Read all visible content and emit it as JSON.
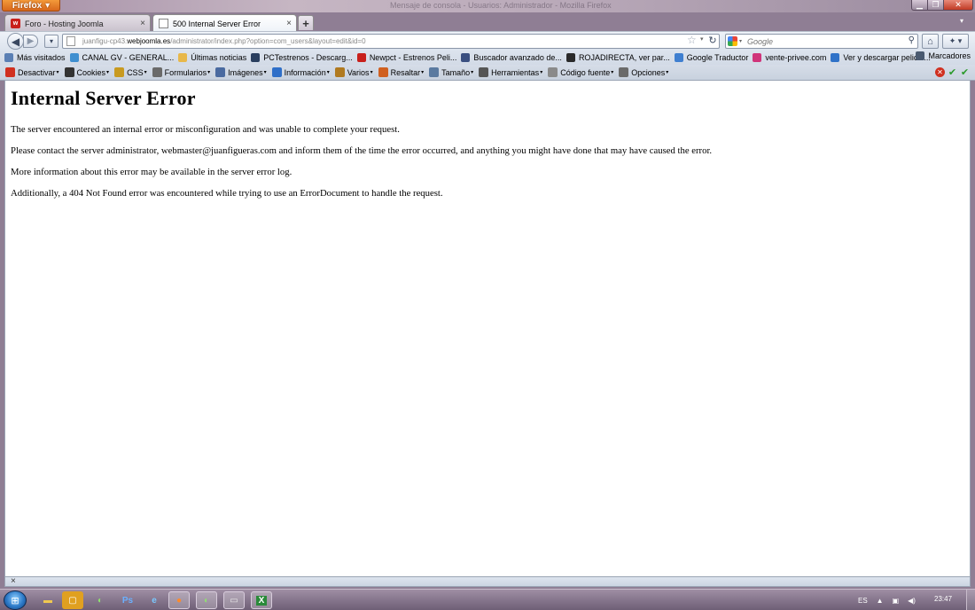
{
  "titlebar": {
    "menu_label": "Firefox",
    "window_title": "Mensaje de consola - Usuarios: Administrador - Mozilla Firefox"
  },
  "tabs": [
    {
      "label": "Foro - Hosting Joomla",
      "active": false
    },
    {
      "label": "500 Internal Server Error",
      "active": true
    }
  ],
  "navbar": {
    "url_prefix": "juanfigu-cp43.",
    "url_host": "webjoomla.es",
    "url_path": "/administrator/index.php?option=com_users&layout=edit&id=0",
    "search_placeholder": "Google"
  },
  "bookmarks": {
    "items": [
      {
        "label": "Más visitados",
        "icon": "bookmark-icon",
        "color": "#5a7fb4"
      },
      {
        "label": "CANAL GV - GENERAL...",
        "icon": "rss-icon",
        "color": "#3f8fd0"
      },
      {
        "label": "Últimas noticias",
        "icon": "folder-icon",
        "color": "#e8b84a"
      },
      {
        "label": "PCTestrenos - Descarg...",
        "icon": "film-icon",
        "color": "#2a3f5f"
      },
      {
        "label": "Newpct - Estrenos Peli...",
        "icon": "newpct-icon",
        "color": "#c8201c"
      },
      {
        "label": "Buscador avanzado de...",
        "icon": "grid-icon",
        "color": "#3a4f80"
      },
      {
        "label": "ROJADIRECTA, ver par...",
        "icon": "pen-icon",
        "color": "#2a2a2a"
      },
      {
        "label": "Google Traductor",
        "icon": "translate-icon",
        "color": "#3f7fd0"
      },
      {
        "label": "vente-privee.com",
        "icon": "vp-icon",
        "color": "#d0347a"
      },
      {
        "label": "Ver y descargar pelicul...",
        "icon": "tp-icon",
        "color": "#2f72c8"
      }
    ],
    "overflow_label": "Marcadores"
  },
  "devbar": {
    "items": [
      {
        "label": "Desactivar",
        "icon": "disable-icon",
        "color": "#d03020"
      },
      {
        "label": "Cookies",
        "icon": "person-icon",
        "color": "#333333"
      },
      {
        "label": "CSS",
        "icon": "pencil-icon",
        "color": "#c89a20"
      },
      {
        "label": "Formularios",
        "icon": "form-icon",
        "color": "#6a6a6a"
      },
      {
        "label": "Imágenes",
        "icon": "image-icon",
        "color": "#4a6aa0"
      },
      {
        "label": "Información",
        "icon": "info-icon",
        "color": "#2f6fc8"
      },
      {
        "label": "Varios",
        "icon": "misc-icon",
        "color": "#b07a20"
      },
      {
        "label": "Resaltar",
        "icon": "highlight-icon",
        "color": "#d06020"
      },
      {
        "label": "Tamaño",
        "icon": "resize-icon",
        "color": "#5a7aa0"
      },
      {
        "label": "Herramientas",
        "icon": "tools-icon",
        "color": "#555555"
      },
      {
        "label": "Código fuente",
        "icon": "source-icon",
        "color": "#8a8a8a"
      },
      {
        "label": "Opciones",
        "icon": "options-icon",
        "color": "#6a6a6a"
      }
    ]
  },
  "page": {
    "heading": "Internal Server Error",
    "paragraphs": [
      "The server encountered an internal error or misconfiguration and was unable to complete your request.",
      "Please contact the server administrator, webmaster@juanfigueras.com and inform them of the time the error occurred, and anything you might have done that may have caused the error.",
      "More information about this error may be available in the server error log.",
      "Additionally, a 404 Not Found error was encountered while trying to use an ErrorDocument to handle the request."
    ]
  },
  "taskbar": {
    "language": "ES",
    "clock": "23:47"
  }
}
